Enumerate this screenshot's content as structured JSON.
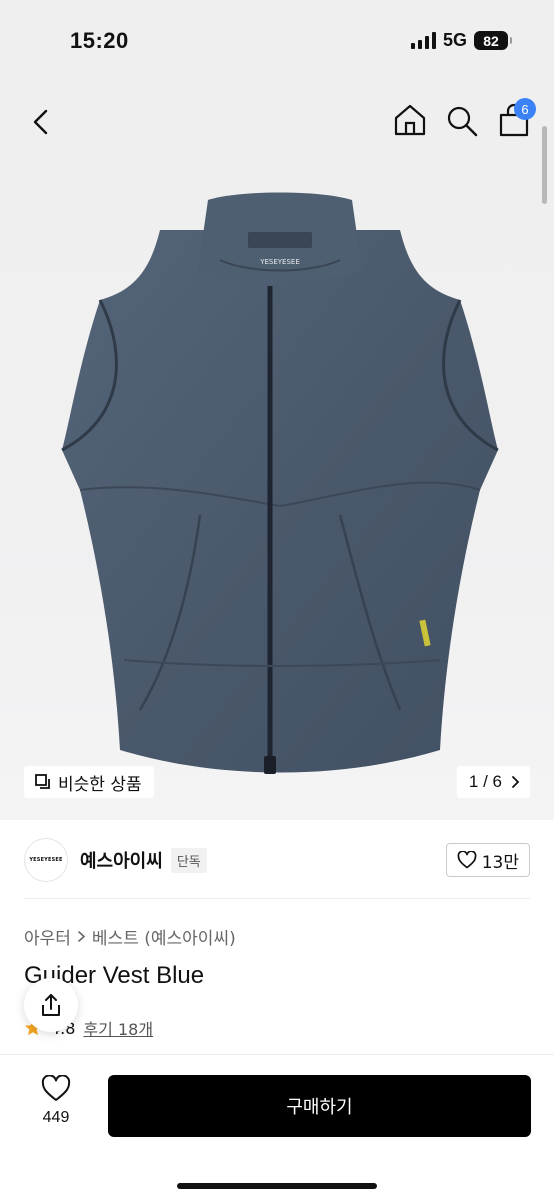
{
  "status_bar": {
    "time": "15:20",
    "network": "5G",
    "battery": "82"
  },
  "nav": {
    "cart_count": "6"
  },
  "hero": {
    "vest_label": "YESEYESEE",
    "similar_label": "비슷한 상품",
    "page_indicator": "1 / 6",
    "vest_color": "#4b5a6b"
  },
  "brand": {
    "logo_text": "YESEYESEE",
    "name": "예스아이씨",
    "badge": "단독",
    "likes": "13만"
  },
  "breadcrumb": {
    "category": "아우터",
    "sub": "베스트 (예스아이씨)"
  },
  "product": {
    "title": "Guider Vest Blue",
    "rating": "4.8",
    "reviews": "후기 18개"
  },
  "bottom": {
    "wish_count": "449",
    "buy_label": "구매하기"
  },
  "colors": {
    "accent_badge": "#3b82f6",
    "buy_button": "#000000",
    "star": "#f5a623"
  }
}
